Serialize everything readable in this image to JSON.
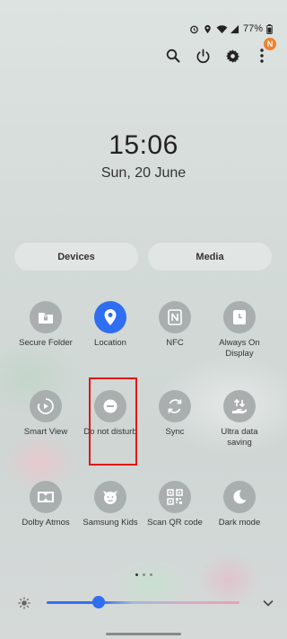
{
  "status_bar": {
    "battery": "77%"
  },
  "clock": {
    "time": "15:06",
    "date": "Sun, 20 June"
  },
  "notification_badge": "N",
  "pills": {
    "devices": "Devices",
    "media": "Media"
  },
  "tiles": [
    {
      "label": "Secure Folder",
      "icon": "secure-folder-icon",
      "active": false
    },
    {
      "label": "Location",
      "icon": "location-icon",
      "active": true
    },
    {
      "label": "NFC",
      "icon": "nfc-icon",
      "active": false
    },
    {
      "label": "Always On Display",
      "icon": "always-on-display-icon",
      "active": false
    },
    {
      "label": "Smart View",
      "icon": "smart-view-icon",
      "active": false
    },
    {
      "label": "Do not disturb",
      "icon": "do-not-disturb-icon",
      "active": false
    },
    {
      "label": "Sync",
      "icon": "sync-icon",
      "active": false
    },
    {
      "label": "Ultra data saving",
      "icon": "ultra-data-saving-icon",
      "active": false
    },
    {
      "label": "Dolby Atmos",
      "icon": "dolby-atmos-icon",
      "active": false
    },
    {
      "label": "Samsung Kids",
      "icon": "samsung-kids-icon",
      "active": false
    },
    {
      "label": "Scan QR code",
      "icon": "qr-code-icon",
      "active": false
    },
    {
      "label": "Dark mode",
      "icon": "dark-mode-icon",
      "active": false
    }
  ],
  "brightness_level": 0.27,
  "colors": {
    "accent": "#2f6ef0",
    "tile_off": "#a9aeae",
    "highlight": "#e01818",
    "badge": "#f08030"
  }
}
